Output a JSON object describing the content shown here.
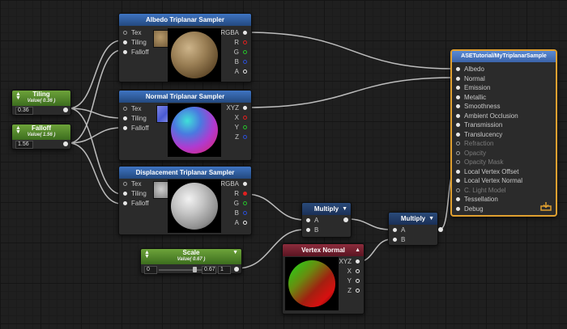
{
  "colors": {
    "albedo_wire": "#c0c0c0",
    "grid_bg": "#1f1f1f",
    "master_border": "#e0a030",
    "vertex_normal_header": "#8c2c3c"
  },
  "tiling": {
    "title": "Tiling",
    "value": "Value( 0.36 )",
    "field": "0.36"
  },
  "falloff": {
    "title": "Falloff",
    "value": "Value( 1.56 )",
    "field": "1.56"
  },
  "albedo": {
    "title": "Albedo Triplanar Sampler",
    "inputs": [
      "Tex",
      "Tiling",
      "Falloff"
    ],
    "outputs": [
      "RGBA",
      "R",
      "G",
      "B",
      "A"
    ]
  },
  "normal": {
    "title": "Normal Triplanar Sampler",
    "inputs": [
      "Tex",
      "Tiling",
      "Falloff"
    ],
    "outputs": [
      "XYZ",
      "X",
      "Y",
      "Z"
    ]
  },
  "displacement": {
    "title": "Displacement Triplanar Sampler",
    "inputs": [
      "Tex",
      "Tiling",
      "Falloff"
    ],
    "outputs": [
      "RGBA",
      "R",
      "G",
      "B",
      "A"
    ]
  },
  "multiply1": {
    "title": "Multiply",
    "inputs": [
      "A",
      "B"
    ]
  },
  "multiply2": {
    "title": "Multiply",
    "inputs": [
      "A",
      "B"
    ]
  },
  "scale": {
    "title": "Scale",
    "value": "Value( 0.67 )",
    "slider_min": "0",
    "slider_value": "0.67",
    "slider_max": "1",
    "slider_fraction": 0.67
  },
  "vertex_normal": {
    "title": "Vertex Normal",
    "outputs": [
      "XYZ",
      "X",
      "Y",
      "Z"
    ]
  },
  "master": {
    "title": "ASETutorial/MyTriplanarSample",
    "ports": [
      "Albedo",
      "Normal",
      "Emission",
      "Metallic",
      "Smoothness",
      "Ambient Occlusion",
      "Transmission",
      "Translucency",
      "Refraction",
      "Opacity",
      "Opacity Mask",
      "Local Vertex Offset",
      "Local Vertex Normal",
      "C. Light Model",
      "Tessellation",
      "Debug"
    ],
    "save_icon": "save-icon"
  }
}
